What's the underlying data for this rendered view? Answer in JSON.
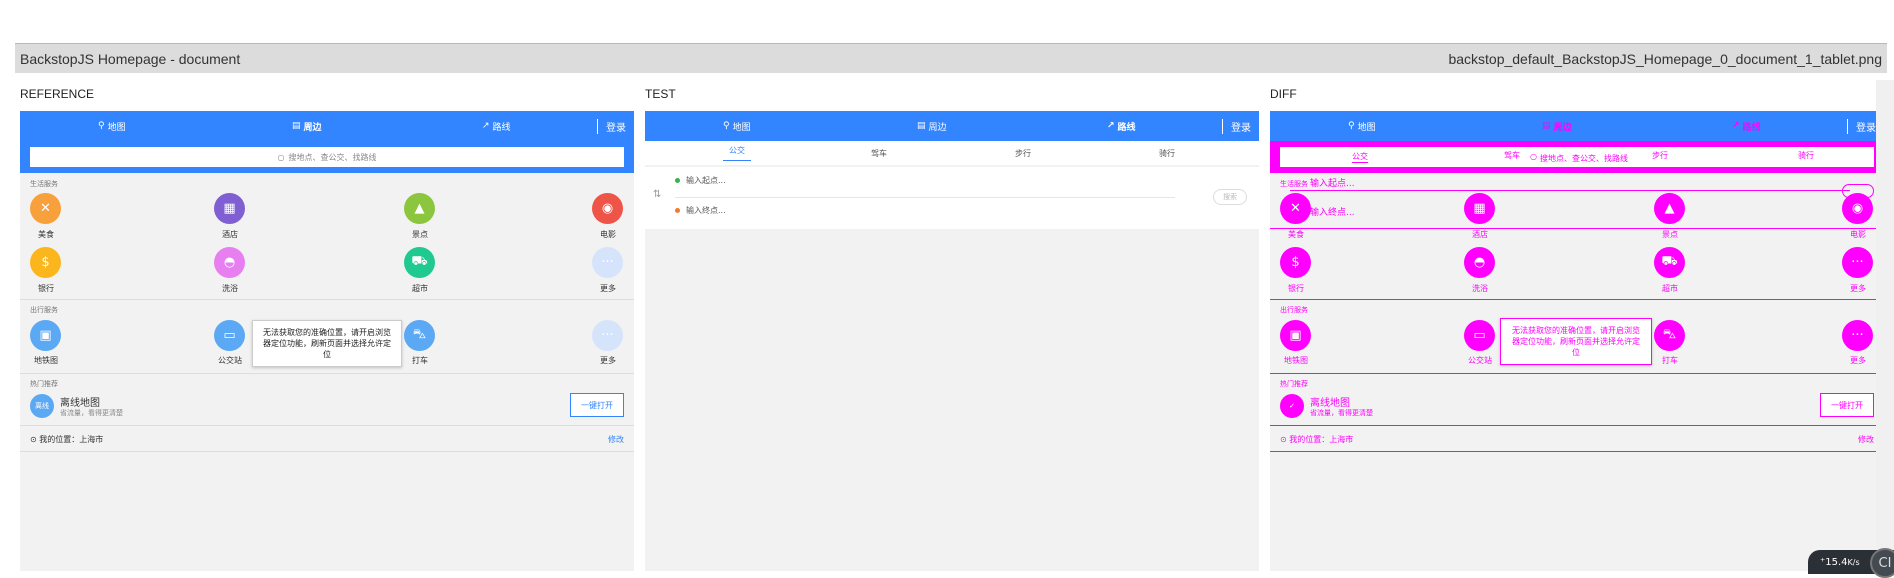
{
  "header": {
    "title": "BackstopJS Homepage - document",
    "filename": "backstop_default_BackstopJS_Homepage_0_document_1_tablet.png"
  },
  "panels": {
    "reference": "REFERENCE",
    "test": "TEST",
    "diff": "DIFF"
  },
  "nav": {
    "map": "地图",
    "nearby": "周边",
    "route": "路线",
    "login": "登录"
  },
  "search": {
    "placeholder": "搜地点、查公交、找路线"
  },
  "sections": {
    "life": "生活服务",
    "travel": "出行服务",
    "hot": "热门推荐"
  },
  "life_items": [
    "美食",
    "酒店",
    "景点",
    "电影",
    "银行",
    "洗浴",
    "超市",
    "更多"
  ],
  "travel_items": [
    "地铁图",
    "公交站",
    "打车",
    "更多"
  ],
  "tooltip": "无法获取您的准确位置，请开启浏览器定位功能，刷新页面并选择允许定位",
  "hot": {
    "title": "离线地图",
    "subtitle": "省流量，看得更清楚",
    "badge": "离线",
    "button": "一键打开"
  },
  "location": {
    "text": "我的位置：上海市",
    "change": "修改"
  },
  "route_tabs": [
    "公交",
    "驾车",
    "步行",
    "骑行"
  ],
  "route": {
    "start": "输入起点...",
    "end": "输入终点...",
    "search": "搜索"
  },
  "speed": {
    "value": "15.4",
    "unit": "K/s",
    "badge": "CI"
  },
  "colors": {
    "blue": "#3385ff",
    "magenta": "#ff00ff"
  }
}
